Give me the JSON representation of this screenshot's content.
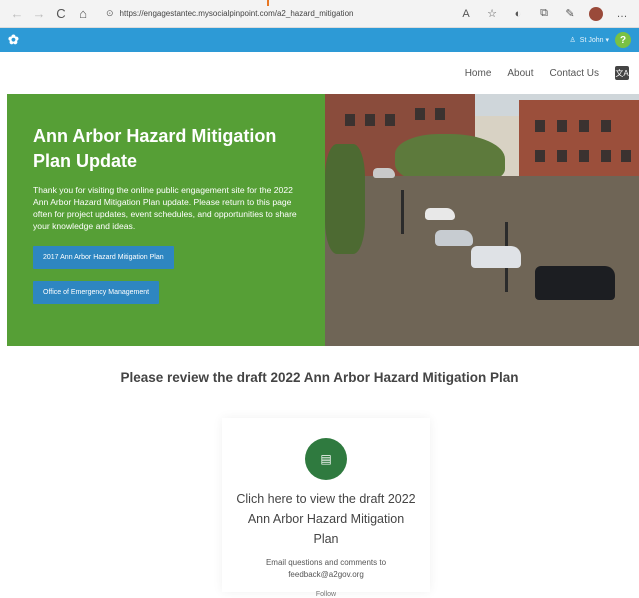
{
  "browser": {
    "back": "←",
    "forward": "→",
    "reload": "C",
    "home": "⌂",
    "url": "https://engagestantec.mysocialpinpoint.com/a2_hazard_mitigation",
    "lock": "⊙",
    "icons": [
      "A",
      "☆",
      "◐",
      "⧉",
      "✎",
      "…"
    ]
  },
  "site": {
    "logo": "✿",
    "user": "St John ▾",
    "help": "?"
  },
  "nav": {
    "items": [
      "Home",
      "About",
      "Contact Us"
    ],
    "translate": "文A"
  },
  "hero": {
    "title": "Ann Arbor Hazard Mitigation Plan Update",
    "body": "Thank you for visiting the online public engagement site for the 2022 Ann Arbor Hazard Mitigation Plan update. Please return to this page often for project updates, event schedules, and opportunities to share your knowledge and ideas.",
    "button1": "2017 Ann Arbor Hazard Mitigation Plan",
    "button2": "Office of Emergency Management",
    "image_alt": "flooded street"
  },
  "section": {
    "title": "Please review the draft 2022 Ann Arbor Hazard Mitigation Plan"
  },
  "card": {
    "icon": "▤",
    "link": "Clich here to view the draft 2022 Ann Arbor Hazard Mitigation Plan",
    "note_line1": "Email questions and comments to",
    "note_line2": "feedback@a2gov.org",
    "more": "Follow"
  }
}
